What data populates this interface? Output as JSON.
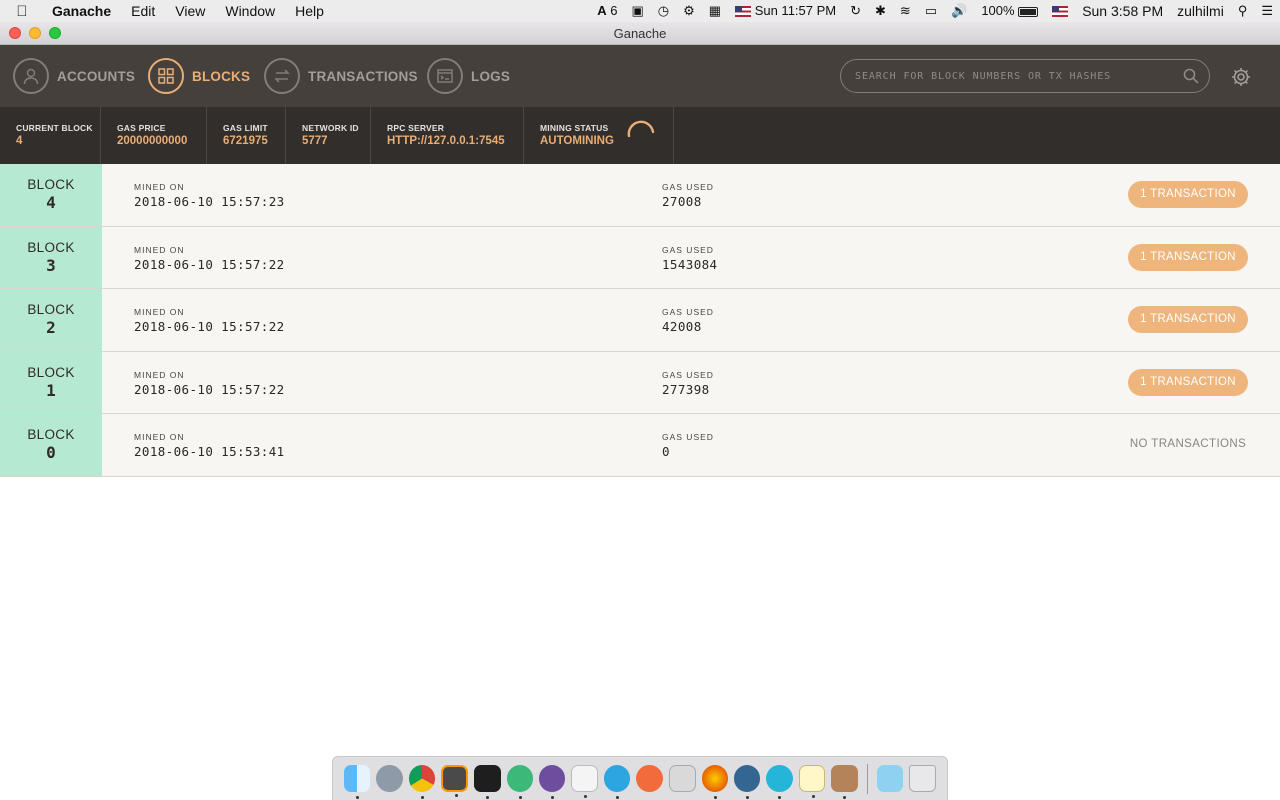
{
  "menubar": {
    "app_name": "Ganache",
    "menus": [
      "Edit",
      "View",
      "Window",
      "Help"
    ],
    "status": {
      "adobe_count": "6",
      "clock1": "Sun 11:57 PM",
      "battery": "100%",
      "clock2": "Sun 3:58 PM",
      "user": "zulhilmi"
    }
  },
  "window": {
    "title": "Ganache"
  },
  "nav": {
    "accounts": "ACCOUNTS",
    "blocks": "BLOCKS",
    "transactions": "TRANSACTIONS",
    "logs": "LOGS",
    "active": "blocks"
  },
  "search": {
    "placeholder": "SEARCH FOR BLOCK NUMBERS OR TX HASHES"
  },
  "stats": {
    "current_block": {
      "label": "CURRENT BLOCK",
      "value": "4"
    },
    "gas_price": {
      "label": "GAS PRICE",
      "value": "20000000000"
    },
    "gas_limit": {
      "label": "GAS LIMIT",
      "value": "6721975"
    },
    "network_id": {
      "label": "NETWORK ID",
      "value": "5777"
    },
    "rpc_server": {
      "label": "RPC SERVER",
      "value": "HTTP://127.0.0.1:7545"
    },
    "mining_status": {
      "label": "MINING STATUS",
      "value": "AUTOMINING"
    }
  },
  "labels": {
    "block": "BLOCK",
    "mined_on": "MINED ON",
    "gas_used": "GAS USED"
  },
  "blocks": [
    {
      "number": "4",
      "mined_on": "2018-06-10 15:57:23",
      "gas_used": "27008",
      "tx": "1 TRANSACTION"
    },
    {
      "number": "3",
      "mined_on": "2018-06-10 15:57:22",
      "gas_used": "1543084",
      "tx": "1 TRANSACTION"
    },
    {
      "number": "2",
      "mined_on": "2018-06-10 15:57:22",
      "gas_used": "42008",
      "tx": "1 TRANSACTION"
    },
    {
      "number": "1",
      "mined_on": "2018-06-10 15:57:22",
      "gas_used": "277398",
      "tx": "1 TRANSACTION"
    },
    {
      "number": "0",
      "mined_on": "2018-06-10 15:53:41",
      "gas_used": "0",
      "no_tx": "NO TRANSACTIONS"
    }
  ],
  "colors": {
    "accent": "#e9ad76",
    "header_bg": "#45403c",
    "stats_bg": "#322e2b",
    "block_number_bg": "#b6e9d1",
    "tx_badge": "#eeb57d"
  },
  "dock": {
    "apps": [
      "finder-icon",
      "launchpad-icon",
      "chrome-icon",
      "sublime-icon",
      "terminal-icon",
      "atom-icon",
      "github-icon",
      "slack-icon",
      "telegram-icon",
      "postman-icon",
      "disk-utility-icon",
      "firefox-icon",
      "postgres-icon",
      "sound-icon",
      "notes-icon",
      "ganache-icon",
      "downloads-icon",
      "trash-icon"
    ]
  }
}
